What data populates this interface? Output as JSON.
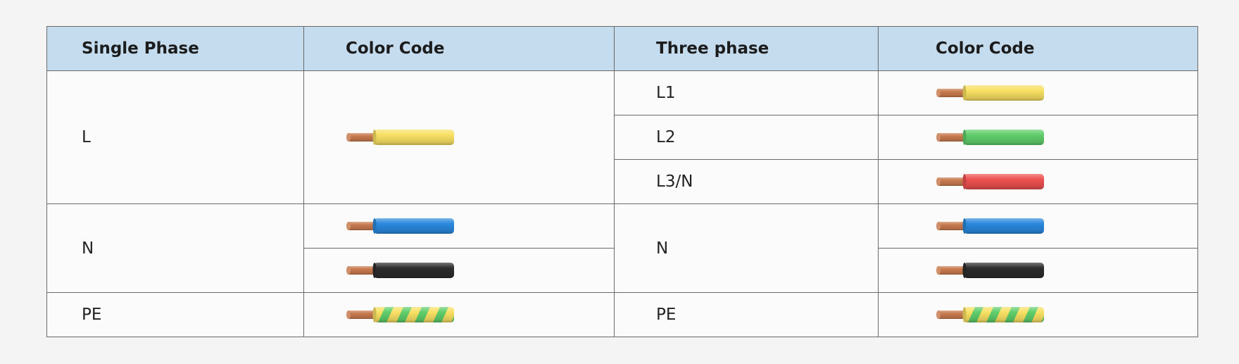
{
  "headers": {
    "single_phase": "Single Phase",
    "color_code_1": "Color Code",
    "three_phase": "Three phase",
    "color_code_2": "Color Code"
  },
  "single_phase": {
    "L": {
      "label": "L",
      "wire_colors": [
        "yellow"
      ]
    },
    "N": {
      "label": "N",
      "wire_colors": [
        "blue",
        "black"
      ]
    },
    "PE": {
      "label": "PE",
      "wire_colors": [
        "green-yellow"
      ]
    }
  },
  "three_phase": {
    "L1": {
      "label": "L1",
      "wire_colors": [
        "yellow"
      ]
    },
    "L2": {
      "label": "L2",
      "wire_colors": [
        "green"
      ]
    },
    "L3N": {
      "label": "L3/N",
      "wire_colors": [
        "red"
      ]
    },
    "N": {
      "label": "N",
      "wire_colors": [
        "blue",
        "black"
      ]
    },
    "PE": {
      "label": "PE",
      "wire_colors": [
        "green-yellow"
      ]
    }
  },
  "colors": {
    "header_bg": "#c5dcef",
    "copper": "#c87a4e",
    "yellow": "#f8e063",
    "green": "#5fcd6a",
    "red": "#ec5050",
    "blue": "#2a88dc",
    "black": "#2c2c2c"
  }
}
